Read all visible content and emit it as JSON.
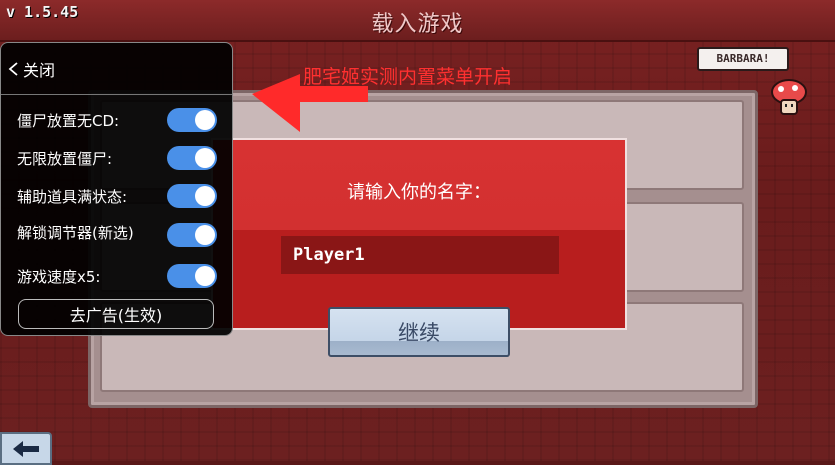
{
  "game": {
    "version": "v 1.5.45",
    "screen_title": "载入游戏",
    "speech_bubble": "BARBARA!"
  },
  "dialog": {
    "prompt": "请输入你的名字：",
    "name_value": "Player1",
    "continue_label": "继续"
  },
  "cheat_menu": {
    "close_label": "关闭",
    "options": [
      {
        "label": "僵尸放置无CD:",
        "enabled": true
      },
      {
        "label": "无限放置僵尸:",
        "enabled": true
      },
      {
        "label": "辅助道具满状态:",
        "enabled": true
      },
      {
        "label": "解锁调节器(新选)",
        "enabled": true
      },
      {
        "label": "游戏速度x5:",
        "enabled": true
      }
    ],
    "ad_button_label": "去广告(生效)"
  },
  "annotation": {
    "text": "肥宅姬实测内置菜单开启",
    "color": "#ff3030"
  },
  "colors": {
    "toggle_on": "#4a90e8",
    "dialog_red": "#d83232",
    "continue_button": "#c5d5e8"
  }
}
